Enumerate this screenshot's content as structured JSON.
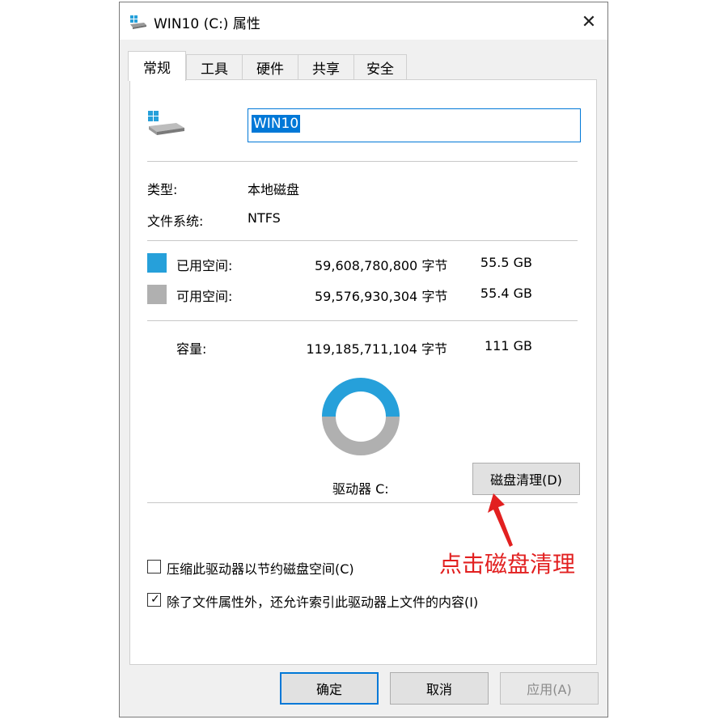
{
  "window": {
    "title": "WIN10 (C:) 属性",
    "close_glyph": "✕"
  },
  "tabs": [
    {
      "label": "常规",
      "active": true
    },
    {
      "label": "工具",
      "active": false
    },
    {
      "label": "硬件",
      "active": false
    },
    {
      "label": "共享",
      "active": false
    },
    {
      "label": "安全",
      "active": false
    }
  ],
  "general": {
    "drive_name": "WIN10",
    "type_label": "类型:",
    "type_value": "本地磁盘",
    "fs_label": "文件系统:",
    "fs_value": "NTFS",
    "used_label": "已用空间:",
    "used_bytes": "59,608,780,800 字节",
    "used_size": "55.5 GB",
    "free_label": "可用空间:",
    "free_bytes": "59,576,930,304 字节",
    "free_size": "55.4 GB",
    "capacity_label": "容量:",
    "capacity_bytes": "119,185,711,104 字节",
    "capacity_size": "111 GB",
    "drive_label": "驱动器 C:",
    "cleanup_button": "磁盘清理(D)",
    "used_fraction": 0.5001,
    "colors": {
      "used": "#26a0da",
      "free": "#b0b0b0"
    }
  },
  "options": {
    "compress_label": "压缩此驱动器以节约磁盘空间(C)",
    "compress_checked": false,
    "index_label": "除了文件属性外，还允许索引此驱动器上文件的内容(I)",
    "index_checked": true
  },
  "footer": {
    "ok": "确定",
    "cancel": "取消",
    "apply": "应用(A)"
  },
  "annotation": {
    "text": "点击磁盘清理",
    "color": "#e22020"
  }
}
